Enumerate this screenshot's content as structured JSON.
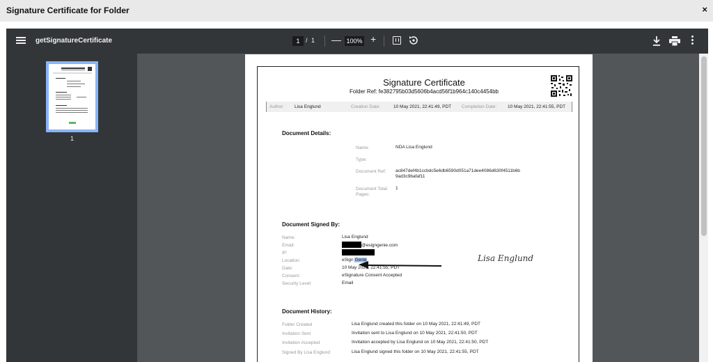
{
  "dialog": {
    "title": "Signature Certificate for Folder",
    "close_label": "×"
  },
  "toolbar": {
    "doc_title": "getSignatureCertificate",
    "page_current": "1",
    "page_separator": "/",
    "page_total": "1",
    "zoom_out": "—",
    "zoom": "100%",
    "zoom_in": "+"
  },
  "sidebar": {
    "thumb_page": "1"
  },
  "certificate": {
    "title": "Signature Certificate",
    "folder_ref": "Folder Ref: fe382795b03d5606b4acd56f1b964c140c4454bb",
    "meta": {
      "author_label": "Author:",
      "author": "Lisa Englund",
      "creation_label": "Creation Date:",
      "creation": "10 May 2021, 22:41:49, PDT",
      "completion_label": "Completion Date:",
      "completion": "10 May 2021, 22:41:55, PDT"
    },
    "doc_details": {
      "heading": "Document Details:",
      "name_label": "Name:",
      "name": "NDA Lisa Englund",
      "type_label": "Type:",
      "ref_label": "Document Ref:",
      "ref_line1": "ac847def4b1ccbdc5e6db6590d051a71dee4086d630f4511b6b",
      "ref_line2": "9ad3c9bafaf11",
      "pages_label_1": "Document Total",
      "pages_label_2": "Pages:",
      "pages": "1"
    },
    "signed_by": {
      "heading": "Document Signed By:",
      "name_label": "Name:",
      "name": "Lisa Englund",
      "email_label": "Email:",
      "email_suffix": "@esigngenie.com",
      "ip_label": "IP:",
      "location_label": "Location:",
      "location_prefix": "eSign ",
      "location_highlight": "Genie",
      "date_label": "Date:",
      "date": "10 May 2021, 22:41:55, PDT",
      "consent_label": "Consent:",
      "consent": "eSignature Consent Accepted",
      "security_label": "Security Level:",
      "security": "Email",
      "signature": "Lisa Englund"
    },
    "history": {
      "heading": "Document History:",
      "rows": [
        {
          "event": "Folder Created",
          "detail": "Lisa Englund created this folder on 10 May 2021, 22:41:49, PDT"
        },
        {
          "event": "Invitation Sent",
          "detail": "Invitation sent to Lisa Englund on 10 May 2021, 22:41:50, PDT"
        },
        {
          "event": "Invitation Accepted",
          "detail": "Invitation accepted by Lisa Englund on 10 May 2021, 22:41:50, PDT"
        },
        {
          "event": "Signed By Lisa Englund",
          "detail": "Lisa Englund signed this folder on 10 May 2021, 22:41:55, PDT"
        }
      ]
    }
  },
  "icons": {
    "menu": "menu-icon",
    "fit": "fit-page-icon",
    "rotate": "rotate-icon",
    "download": "download-icon",
    "print": "print-icon",
    "more": "more-vert-icon",
    "close": "close-icon",
    "qr": "qr-code-icon",
    "arrow": "arrow-left-icon"
  },
  "colors": {
    "toolbar": "#323639",
    "viewer_bg": "#525659",
    "thumb_border": "#8ab4f8",
    "highlight": "#a7c5ec"
  }
}
